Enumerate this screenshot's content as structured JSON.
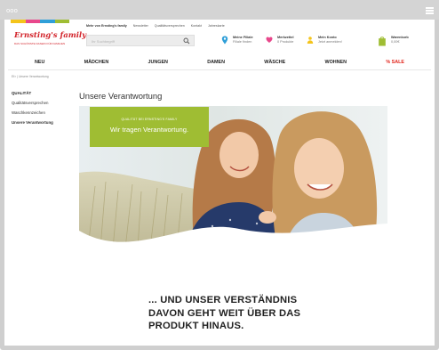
{
  "browser": {
    "dots": "ooo",
    "menu_icon": "hamburger-icon"
  },
  "brand": {
    "name": "Ernsting's family",
    "tagline": "DAS SCHÖNSTE DASEIN FÜR FAMILIEN",
    "stripe_colors": [
      "#f4c41b",
      "#e8478b",
      "#2f9fd8",
      "#9fbd33"
    ],
    "color": "#d2232a"
  },
  "toplinks": [
    "Mehr von Ernsting's family",
    "Newsletter",
    "Qualitätsversprechen",
    "Kontakt",
    "Jahreskarte"
  ],
  "search": {
    "placeholder": "Ihr Suchbegriff"
  },
  "utility": {
    "store": {
      "line1": "Meine Filiale",
      "line2": "Filiale finden",
      "icon": "location-pin-icon"
    },
    "wishlist": {
      "line1": "Merkzettel",
      "line2": "0 Produkte",
      "icon": "heart-icon"
    },
    "account": {
      "line1": "Mein Konto",
      "line2": "Jetzt anmelden!",
      "icon": "user-icon"
    },
    "cart": {
      "line1": "Warenkorb",
      "line2": "0,00€",
      "icon": "shopping-bag-icon"
    }
  },
  "nav": [
    "NEU",
    "MÄDCHEN",
    "JUNGEN",
    "DAMEN",
    "WÄSCHE",
    "WOHNEN",
    "% SALE"
  ],
  "breadcrumb": "Ef> | Unsere Verantwortung",
  "sidebar": {
    "header": "QUALITÄT",
    "items": [
      "Qualitätsversprechen",
      "Waschkennzeichen",
      "Unsere Verantwortung"
    ]
  },
  "page_title": "Unsere Verantwortung",
  "hero": {
    "kicker": "QUALITÄT BEI ERNSTING'S FAMILY",
    "headline": "Wir tragen Verantwortung.",
    "accent": "#9fbd33"
  },
  "statement": [
    "... UND UNSER VERSTÄNDNIS",
    "DAVON GEHT WEIT ÜBER DAS",
    "PRODUKT HINAUS."
  ]
}
